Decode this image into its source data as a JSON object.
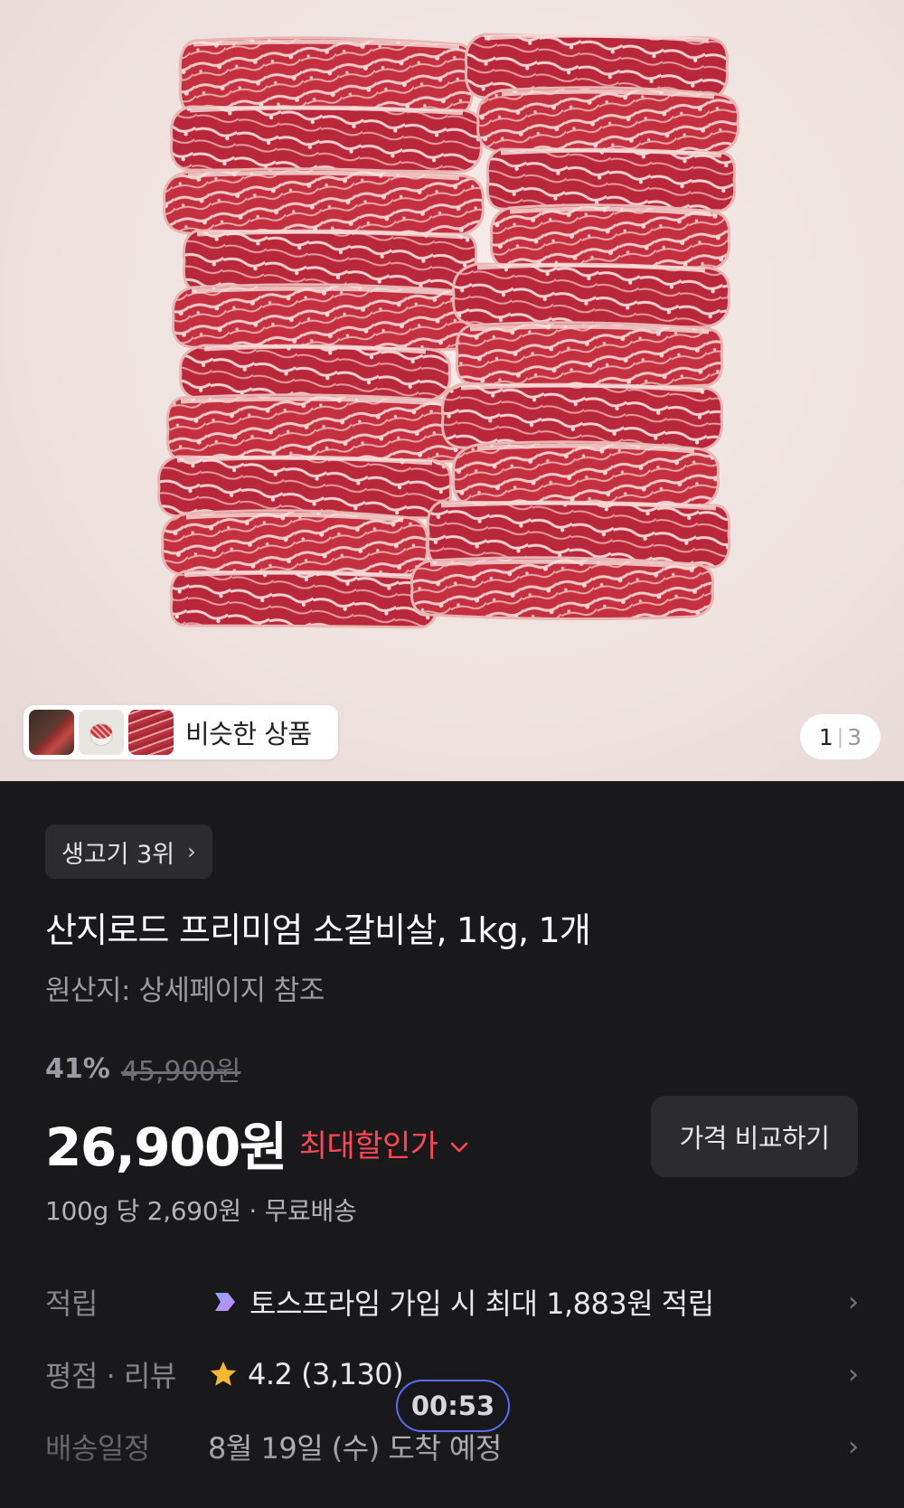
{
  "image": {
    "similar_label": "비슷한 상품",
    "page_current": "1",
    "page_separator": "|",
    "page_total": "3"
  },
  "rank": {
    "label": "생고기 3위",
    "chevron": "›"
  },
  "product": {
    "title": "산지로드 프리미엄 소갈비살, 1kg, 1개",
    "origin": "원산지: 상세페이지 참조",
    "discount": "41%",
    "original_price": "45,900원",
    "price": "26,900원",
    "max_discount_label": "최대할인가",
    "compare_button": "가격 비교하기",
    "unit_info": "100g 당 2,690원 · 무료배송"
  },
  "rows": [
    {
      "label": "적립",
      "value": "토스프라임 가입 시 최대 1,883원 적립",
      "icon": "toss-prime-icon"
    },
    {
      "label": "평점 · 리뷰",
      "value": "4.2 (3,130)",
      "icon": "star-icon"
    },
    {
      "label": "배송일정",
      "value": "8월 19일 (수) 도착 예정"
    }
  ],
  "overlay": {
    "timer": "00:53"
  },
  "colors": {
    "background": "#19191c",
    "accent_red": "#ff4653",
    "chip_bg": "#2c2c30",
    "star": "#f7b731"
  }
}
